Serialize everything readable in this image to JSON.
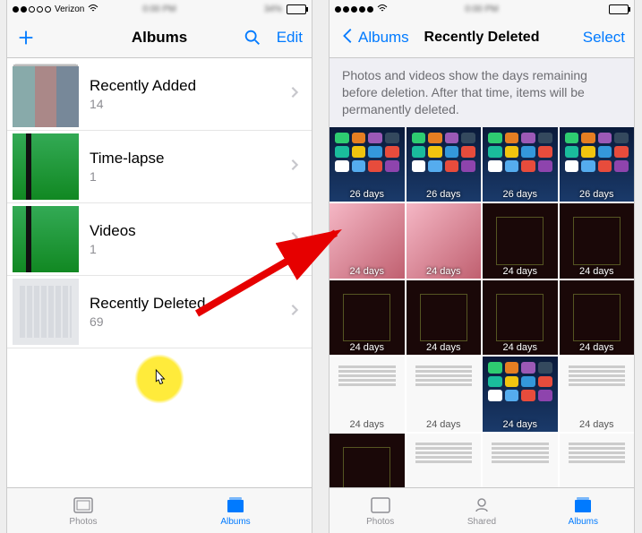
{
  "left": {
    "status": {
      "carrier": "Verizon",
      "battery_pct": "34%"
    },
    "nav": {
      "title": "Albums",
      "edit": "Edit"
    },
    "albums": [
      {
        "name": "Recently Added",
        "count": "14"
      },
      {
        "name": "Time-lapse",
        "count": "1"
      },
      {
        "name": "Videos",
        "count": "1"
      },
      {
        "name": "Recently Deleted",
        "count": "69"
      }
    ],
    "tabs": {
      "photos": "Photos",
      "albums": "Albums"
    }
  },
  "right": {
    "nav": {
      "back": "Albums",
      "title": "Recently Deleted",
      "select": "Select"
    },
    "banner": "Photos and videos show the days remaining before deletion. After that time, items will be permanently deleted.",
    "grid": [
      {
        "label": "26 days",
        "kind": "home"
      },
      {
        "label": "26 days",
        "kind": "home"
      },
      {
        "label": "26 days",
        "kind": "home"
      },
      {
        "label": "26 days",
        "kind": "home"
      },
      {
        "label": "24 days",
        "kind": "pink"
      },
      {
        "label": "24 days",
        "kind": "pink"
      },
      {
        "label": "24 days",
        "kind": "dark"
      },
      {
        "label": "24 days",
        "kind": "dark"
      },
      {
        "label": "24 days",
        "kind": "dark"
      },
      {
        "label": "24 days",
        "kind": "dark"
      },
      {
        "label": "24 days",
        "kind": "dark"
      },
      {
        "label": "24 days",
        "kind": "dark"
      },
      {
        "label": "24 days",
        "kind": "white"
      },
      {
        "label": "24 days",
        "kind": "white"
      },
      {
        "label": "24 days",
        "kind": "home"
      },
      {
        "label": "24 days",
        "kind": "white"
      },
      {
        "label": "",
        "kind": "dark"
      },
      {
        "label": "",
        "kind": "white"
      },
      {
        "label": "",
        "kind": "white"
      },
      {
        "label": "",
        "kind": "white"
      }
    ],
    "tabs": {
      "photos": "Photos",
      "shared": "Shared",
      "albums": "Albums"
    }
  }
}
